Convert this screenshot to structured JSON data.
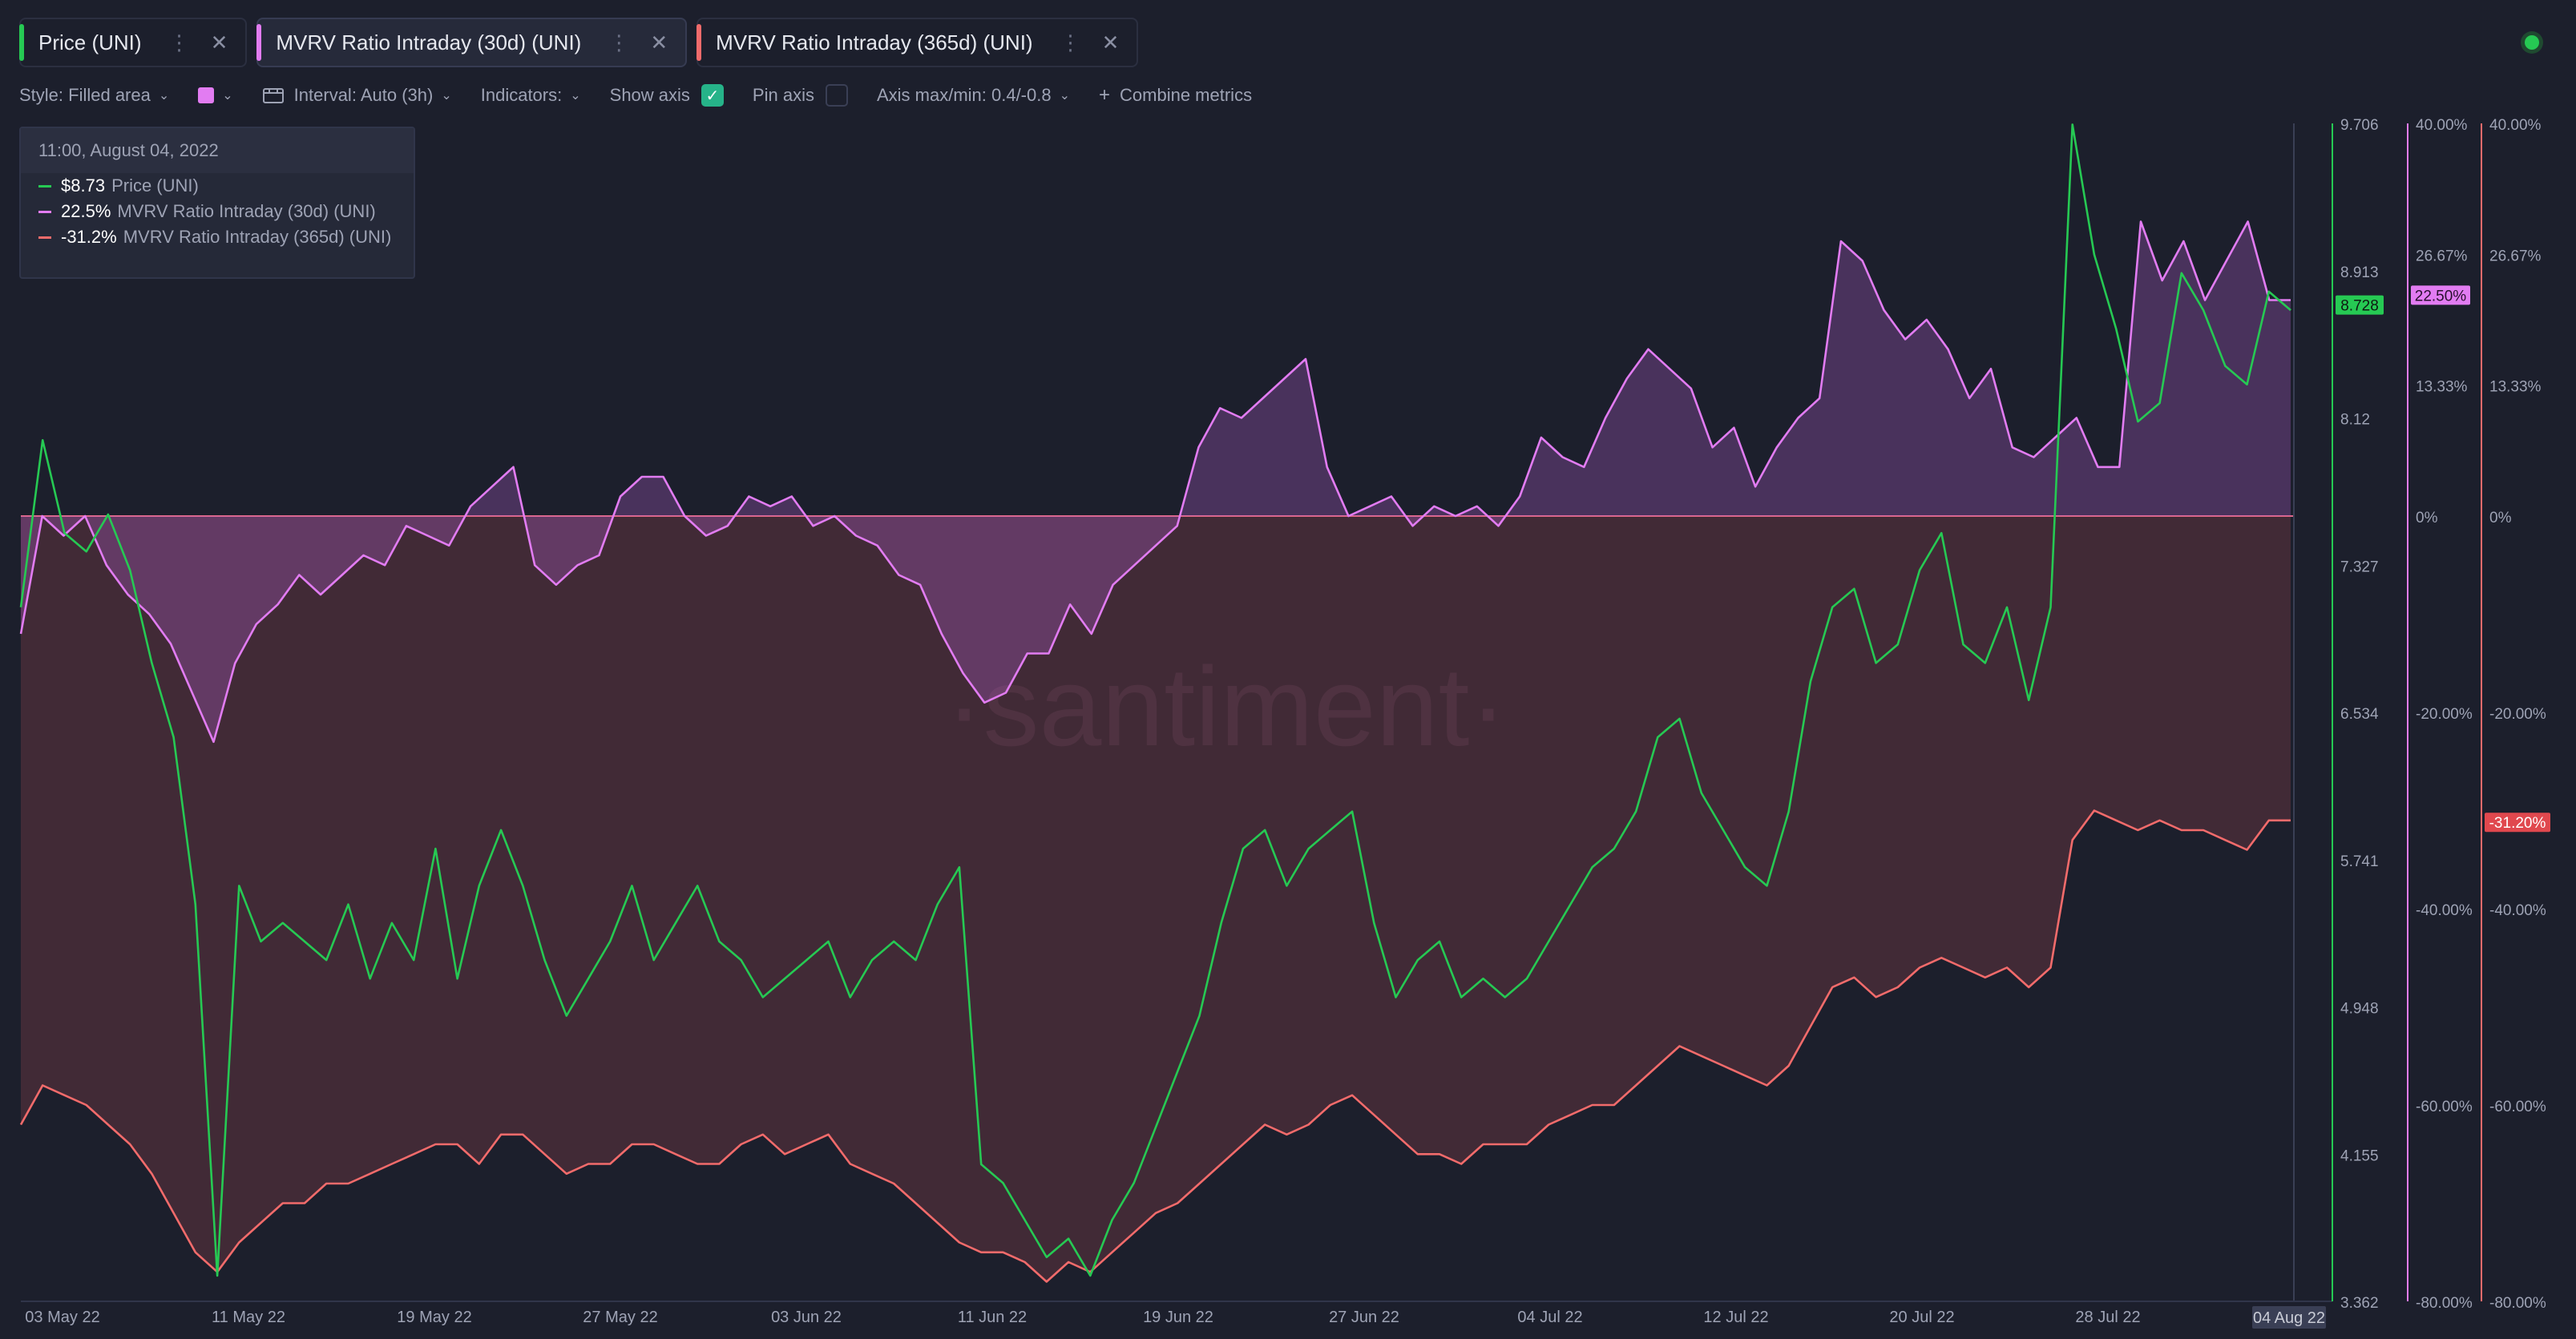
{
  "tabs": [
    {
      "label": "Price (UNI)",
      "color": "#26c953"
    },
    {
      "label": "MVRV Ratio Intraday (30d) (UNI)",
      "color": "#e27cf2"
    },
    {
      "label": "MVRV Ratio Intraday (365d) (UNI)",
      "color": "#f26b6b"
    }
  ],
  "toolbar": {
    "style_label": "Style: Filled area",
    "interval_label": "Interval: Auto (3h)",
    "indicators_label": "Indicators:",
    "show_axis_label": "Show axis",
    "pin_axis_label": "Pin axis",
    "axis_label": "Axis max/min: 0.4/-0.8",
    "combine_label": "Combine metrics"
  },
  "tooltip": {
    "date": "11:00, August 04, 2022",
    "rows": [
      {
        "value": "$8.73",
        "name": "Price (UNI)"
      },
      {
        "value": "22.5%",
        "name": "MVRV Ratio Intraday (30d) (UNI)"
      },
      {
        "value": "-31.2%",
        "name": "MVRV Ratio Intraday (365d) (UNI)"
      }
    ]
  },
  "watermark": "·santiment·",
  "chart_data": {
    "type": "line",
    "x_ticks": [
      "03 May 22",
      "11 May 22",
      "19 May 22",
      "27 May 22",
      "03 Jun 22",
      "11 Jun 22",
      "19 Jun 22",
      "27 Jun 22",
      "04 Jul 22",
      "12 Jul 22",
      "20 Jul 22",
      "28 Jul 22"
    ],
    "x_current": "04 Aug 22",
    "price_axis": {
      "ticks": [
        "9.706",
        "8.913",
        "8.12",
        "7.327",
        "6.534",
        "5.741",
        "4.948",
        "4.155",
        "3.362"
      ],
      "current": "8.728",
      "range": [
        3.362,
        9.706
      ]
    },
    "mvrv_axis": {
      "ticks": [
        "40.00%",
        "26.67%",
        "13.33%",
        "0%",
        "-20.00%",
        "-40.00%",
        "-60.00%",
        "-80.00%"
      ],
      "current_30d": "22.50%",
      "current_365d": "-31.20%",
      "min": -80,
      "max": 40
    },
    "series": [
      {
        "name": "Price (UNI)",
        "unit": "$",
        "color": "#26c953",
        "values": [
          7.1,
          8.0,
          7.5,
          7.4,
          7.6,
          7.3,
          6.8,
          6.4,
          5.5,
          3.5,
          5.6,
          5.3,
          5.4,
          5.3,
          5.2,
          5.5,
          5.1,
          5.4,
          5.2,
          5.8,
          5.1,
          5.6,
          5.9,
          5.6,
          5.2,
          4.9,
          5.1,
          5.3,
          5.6,
          5.2,
          5.4,
          5.6,
          5.3,
          5.2,
          5.0,
          5.1,
          5.2,
          5.3,
          5.0,
          5.2,
          5.3,
          5.2,
          5.5,
          5.7,
          4.1,
          4.0,
          3.8,
          3.6,
          3.7,
          3.5,
          3.8,
          4.0,
          4.3,
          4.6,
          4.9,
          5.4,
          5.8,
          5.9,
          5.6,
          5.8,
          5.9,
          6.0,
          5.4,
          5.0,
          5.2,
          5.3,
          5.0,
          5.1,
          5.0,
          5.1,
          5.3,
          5.5,
          5.7,
          5.8,
          6.0,
          6.4,
          6.5,
          6.1,
          5.9,
          5.7,
          5.6,
          6.0,
          6.7,
          7.1,
          7.2,
          6.8,
          6.9,
          7.3,
          7.5,
          6.9,
          6.8,
          7.1,
          6.6,
          7.1,
          9.7,
          9.0,
          8.6,
          8.1,
          8.2,
          8.9,
          8.7,
          8.4,
          8.3,
          8.8,
          8.7
        ]
      },
      {
        "name": "MVRV Ratio Intraday (30d) (UNI)",
        "unit": "%",
        "color": "#e27cf2",
        "values": [
          -12,
          0,
          -2,
          0,
          -5,
          -8,
          -10,
          -13,
          -18,
          -23,
          -15,
          -11,
          -9,
          -6,
          -8,
          -6,
          -4,
          -5,
          -1,
          -2,
          -3,
          1,
          3,
          5,
          -5,
          -7,
          -5,
          -4,
          2,
          4,
          4,
          0,
          -2,
          -1,
          2,
          1,
          2,
          -1,
          0,
          -2,
          -3,
          -6,
          -7,
          -12,
          -16,
          -19,
          -18,
          -14,
          -14,
          -9,
          -12,
          -7,
          -5,
          -3,
          -1,
          7,
          11,
          10,
          12,
          14,
          16,
          5,
          0,
          1,
          2,
          -1,
          1,
          0,
          1,
          -1,
          2,
          8,
          6,
          5,
          10,
          14,
          17,
          15,
          13,
          7,
          9,
          3,
          7,
          10,
          12,
          28,
          26,
          21,
          18,
          20,
          17,
          12,
          15,
          7,
          6,
          8,
          10,
          5,
          5,
          30,
          24,
          28,
          22,
          26,
          30,
          22,
          22
        ]
      },
      {
        "name": "MVRV Ratio Intraday (365d) (UNI)",
        "unit": "%",
        "color": "#f26b6b",
        "values": [
          -62,
          -58,
          -59,
          -60,
          -62,
          -64,
          -67,
          -71,
          -75,
          -77,
          -74,
          -72,
          -70,
          -70,
          -68,
          -68,
          -67,
          -66,
          -65,
          -64,
          -64,
          -66,
          -63,
          -63,
          -65,
          -67,
          -66,
          -66,
          -64,
          -64,
          -65,
          -66,
          -66,
          -64,
          -63,
          -65,
          -64,
          -63,
          -66,
          -67,
          -68,
          -70,
          -72,
          -74,
          -75,
          -75,
          -76,
          -78,
          -76,
          -77,
          -75,
          -73,
          -71,
          -70,
          -68,
          -66,
          -64,
          -62,
          -63,
          -62,
          -60,
          -59,
          -61,
          -63,
          -65,
          -65,
          -66,
          -64,
          -64,
          -64,
          -62,
          -61,
          -60,
          -60,
          -58,
          -56,
          -54,
          -55,
          -56,
          -57,
          -58,
          -56,
          -52,
          -48,
          -47,
          -49,
          -48,
          -46,
          -45,
          -46,
          -47,
          -46,
          -48,
          -46,
          -33,
          -30,
          -31,
          -32,
          -31,
          -32,
          -32,
          -33,
          -34,
          -31,
          -31
        ]
      }
    ]
  }
}
